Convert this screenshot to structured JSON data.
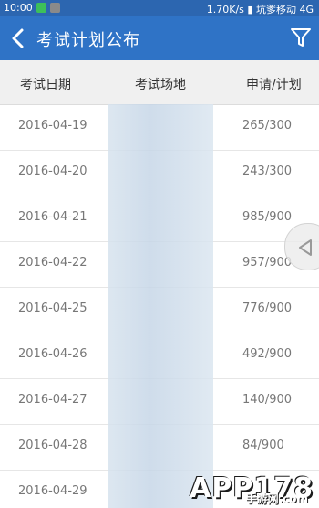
{
  "status_bar": {
    "time": "10:00",
    "speed": "1.70K/s",
    "carrier": "坑爹移动 4G"
  },
  "app_bar": {
    "title": "考试计划公布",
    "back_icon": "back-arrow-icon",
    "filter_icon": "filter-icon"
  },
  "table": {
    "headers": [
      "考试日期",
      "考试场地",
      "申请/计划"
    ],
    "rows": [
      {
        "date": "2016-04-19",
        "venue": "",
        "count": "265/300"
      },
      {
        "date": "2016-04-20",
        "venue": "",
        "count": "243/300"
      },
      {
        "date": "2016-04-21",
        "venue": "",
        "count": "985/900"
      },
      {
        "date": "2016-04-22",
        "venue": "",
        "count": "957/900"
      },
      {
        "date": "2016-04-25",
        "venue": "",
        "count": "776/900"
      },
      {
        "date": "2016-04-26",
        "venue": "",
        "count": "492/900"
      },
      {
        "date": "2016-04-27",
        "venue": "",
        "count": "140/900"
      },
      {
        "date": "2016-04-28",
        "venue": "",
        "count": "84/900"
      },
      {
        "date": "2016-04-29",
        "venue": "",
        "count": ""
      }
    ]
  },
  "watermark": {
    "text": "APP178",
    "sub": "手游网",
    "domain": ".com"
  },
  "colors": {
    "appbar": "#2f73c6",
    "statusbar": "#2c66b0",
    "header_bg": "#f0f0f0",
    "row_text": "#777777"
  }
}
